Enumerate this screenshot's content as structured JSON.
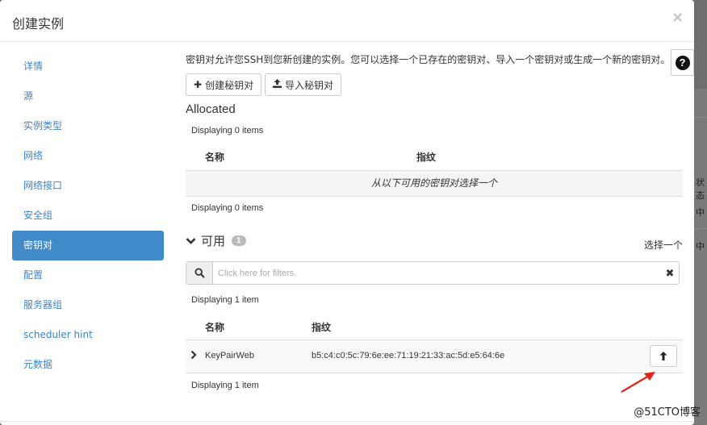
{
  "background": {
    "cells": [
      "状态",
      "中",
      "中"
    ]
  },
  "modal": {
    "title": "创建实例",
    "close_label": "×"
  },
  "sidebar": {
    "items": [
      {
        "label": "详情",
        "active": false
      },
      {
        "label": "源",
        "active": false
      },
      {
        "label": "实例类型",
        "active": false
      },
      {
        "label": "网络",
        "active": false
      },
      {
        "label": "网络接口",
        "active": false
      },
      {
        "label": "安全组",
        "active": false
      },
      {
        "label": "密钥对",
        "active": true
      },
      {
        "label": "配置",
        "active": false
      },
      {
        "label": "服务器组",
        "active": false
      },
      {
        "label": "scheduler hint",
        "active": false
      },
      {
        "label": "元数据",
        "active": false
      }
    ]
  },
  "content": {
    "description": "密钥对允许您SSH到您新创建的实例。您可以选择一个已存在的密钥对、导入一个密钥对或生成一个新的密钥对。",
    "help_label": "?",
    "create_button": "创建秘钥对",
    "import_button": "导入秘钥对",
    "allocated": {
      "title": "Allocated",
      "count_top": "Displaying 0 items",
      "col_name": "名称",
      "col_fingerprint": "指纹",
      "empty_message": "从以下可用的密钥对选择一个",
      "count_bottom": "Displaying 0 items"
    },
    "available": {
      "title": "可用",
      "badge": "1",
      "select_one": "选择一个",
      "search_placeholder": "Click here for filters.",
      "count_top": "Displaying 1 item",
      "col_name": "名称",
      "col_fingerprint": "指纹",
      "rows": [
        {
          "name": "KeyPairWeb",
          "fingerprint": "b5:c4:c0:5c:79:6e:ee:71:19:21:33:ac:5d:e5:64:6e"
        }
      ],
      "count_bottom": "Displaying 1 item"
    }
  },
  "watermark": "@51CTO博客",
  "colors": {
    "accent": "#428bca",
    "annotation_arrow": "#e0241b"
  }
}
